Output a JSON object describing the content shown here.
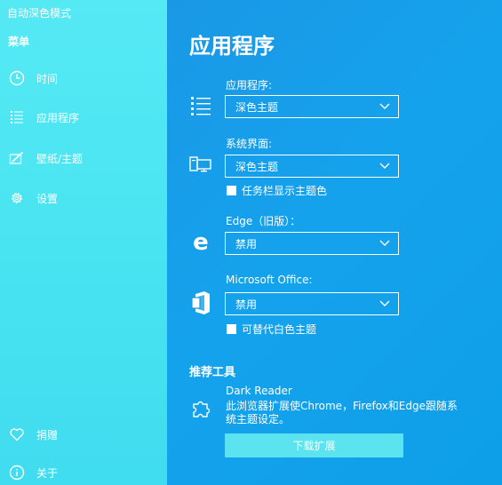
{
  "sidebar": {
    "app_title": "自动深色模式",
    "menu_title": "菜单",
    "items": [
      {
        "label": "时间",
        "icon": "clock-icon"
      },
      {
        "label": "应用程序",
        "icon": "list-icon"
      },
      {
        "label": "壁纸/主题",
        "icon": "paint-icon"
      },
      {
        "label": "设置",
        "icon": "gear-icon"
      }
    ],
    "bottom_items": [
      {
        "label": "捐赠",
        "icon": "heart-icon"
      },
      {
        "label": "关于",
        "icon": "info-icon"
      }
    ]
  },
  "main": {
    "title": "应用程序",
    "apps": {
      "label": "应用程序:",
      "value": "深色主题",
      "icon": "list-icon"
    },
    "system": {
      "label": "系统界面:",
      "value": "深色主题",
      "icon": "monitor-icon",
      "checkbox_label": "任务栏显示主题色"
    },
    "edge": {
      "label": "Edge（旧版）：",
      "value": "禁用",
      "icon": "edge-icon"
    },
    "office": {
      "label": "Microsoft Office:",
      "value": "禁用",
      "icon": "office-icon",
      "checkbox_label": "可替代白色主题"
    },
    "tools": {
      "header": "推荐工具",
      "name": "Dark Reader",
      "description": "此浏览器扩展使Chrome，Firefox和Edge跟随系统主题设定。",
      "button": "下载扩展",
      "icon": "puzzle-icon"
    }
  },
  "colors": {
    "sidebar_bg": "#49e4f2",
    "main_bg": "#1a98e6",
    "button_bg": "#5be3ef",
    "text": "#ffffff"
  }
}
